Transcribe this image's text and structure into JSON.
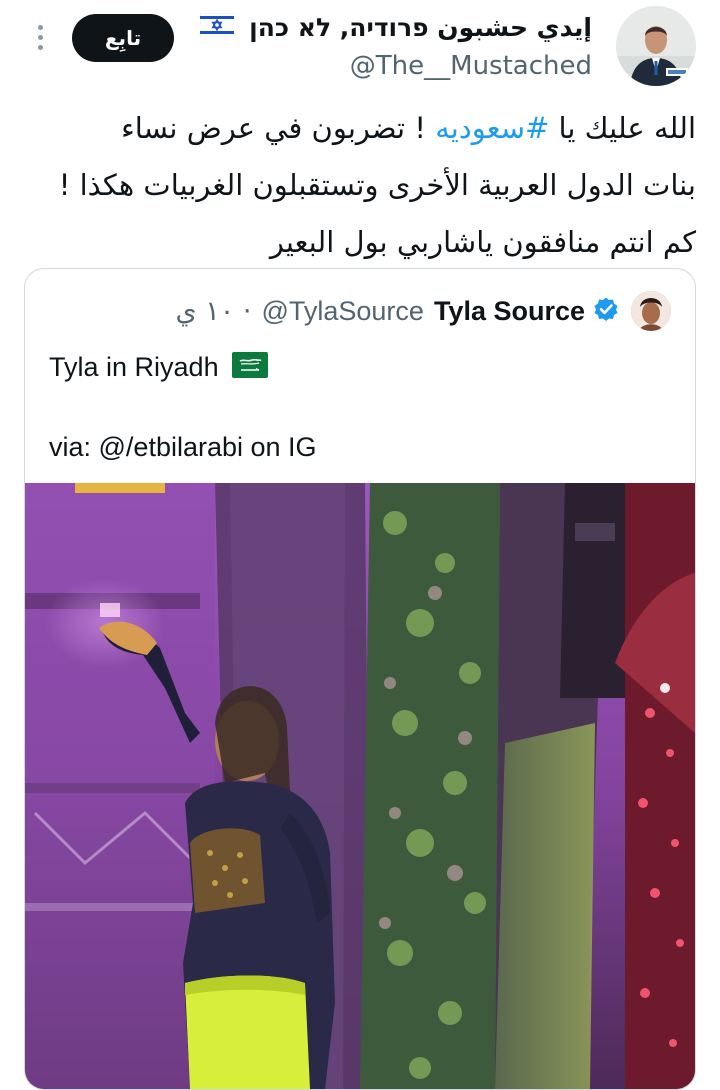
{
  "header": {
    "display_name": "إيدي حشبون פרודיה, לא כהן",
    "handle": "@The__Mustached",
    "follow_label": "تابِع"
  },
  "tweet": {
    "line1_before": "الله عليك يا ",
    "line1_hashtag": "#سعوديه",
    "line1_after": " ! تضربون في عرض نساء",
    "line2": "بنات الدول العربية الأخرى وتستقبلون الغربيات هكذا !",
    "line3": "كم انتم منافقون ياشاربي بول البعير"
  },
  "quote": {
    "name": "Tyla Source",
    "handle": "@TylaSource",
    "time": "· ١٠ ي",
    "text_line1": "Tyla in Riyadh",
    "text_line2": "via: @/etbilarabi on IG"
  },
  "colors": {
    "accent": "#1d9bf0",
    "button_bg": "#0f1419",
    "muted": "#536471",
    "border": "#cfd9de"
  },
  "icons": [
    "israel-flag-icon",
    "more-options-icon",
    "verified-badge-icon",
    "saudi-flag-icon"
  ]
}
